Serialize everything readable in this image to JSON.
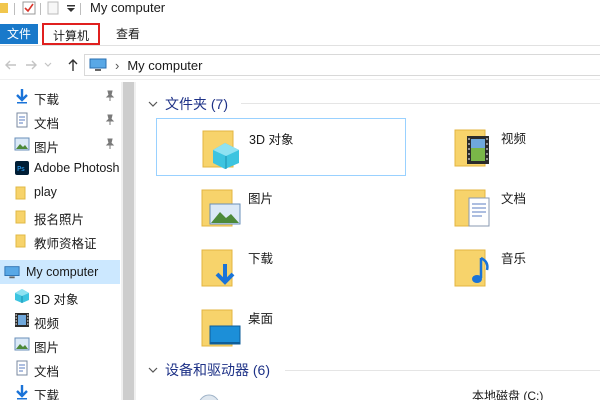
{
  "window": {
    "title": "My computer"
  },
  "ribbon": {
    "tabs": {
      "file": "文件",
      "computer": "计算机",
      "view": "查看"
    }
  },
  "address": {
    "path": "My computer",
    "separator": "›"
  },
  "nav": {
    "quick_access": [
      {
        "label": "下载",
        "icon": "download-arrow-icon",
        "pinned": true
      },
      {
        "label": "文档",
        "icon": "document-icon",
        "pinned": true
      },
      {
        "label": "图片",
        "icon": "pictures-icon",
        "pinned": true
      },
      {
        "label": "Adobe Photosh",
        "icon": "photoshop-icon",
        "pinned": false
      },
      {
        "label": "play",
        "icon": "folder-icon",
        "pinned": false
      },
      {
        "label": "报名照片",
        "icon": "folder-icon",
        "pinned": false
      },
      {
        "label": "教师资格证",
        "icon": "folder-icon",
        "pinned": false
      }
    ],
    "this_pc": {
      "label": "My computer",
      "icon": "computer-icon",
      "selected": true
    },
    "this_pc_children": [
      {
        "label": "3D 对象",
        "icon": "3d-objects-icon"
      },
      {
        "label": "视频",
        "icon": "video-icon"
      },
      {
        "label": "图片",
        "icon": "pictures-icon"
      },
      {
        "label": "文档",
        "icon": "document-icon"
      },
      {
        "label": "下载",
        "icon": "download-arrow-icon"
      }
    ]
  },
  "folders_group": {
    "header": "文件夹 (7)",
    "items": [
      {
        "label": "3D 对象",
        "icon": "3d-objects-folder-icon"
      },
      {
        "label": "视频",
        "icon": "video-folder-icon"
      },
      {
        "label": "图片",
        "icon": "pictures-folder-icon"
      },
      {
        "label": "文档",
        "icon": "documents-folder-icon"
      },
      {
        "label": "下载",
        "icon": "downloads-folder-icon"
      },
      {
        "label": "音乐",
        "icon": "music-folder-icon"
      },
      {
        "label": "桌面",
        "icon": "desktop-folder-icon"
      }
    ]
  },
  "devices_group": {
    "header": "设备和驱动器 (6)",
    "partial_items": [
      {
        "label": "本地磁盘 (C:)"
      }
    ]
  },
  "colors": {
    "accent": "#1979ca",
    "selection": "#cce8ff",
    "header_text": "#1e3287",
    "highlight_box": "#e0201f"
  }
}
